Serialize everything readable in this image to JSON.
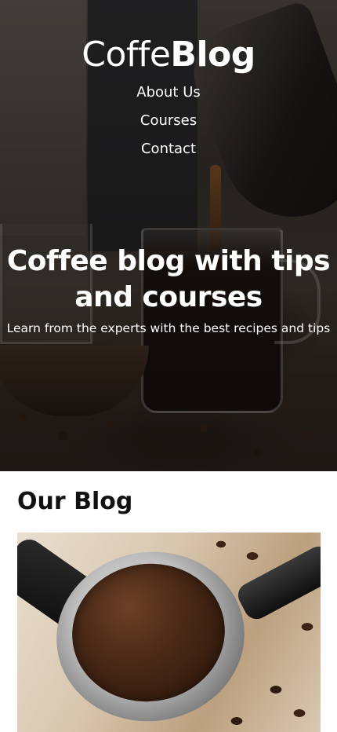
{
  "header": {
    "logo_light": "Coffe",
    "logo_bold": "Blog",
    "nav": [
      {
        "label": "About Us"
      },
      {
        "label": "Courses"
      },
      {
        "label": "Contact"
      }
    ]
  },
  "hero": {
    "title": "Coffee blog with tips and courses",
    "subtitle": "Learn from the experts with the best recipes and tips"
  },
  "blog": {
    "heading": "Our Blog"
  }
}
